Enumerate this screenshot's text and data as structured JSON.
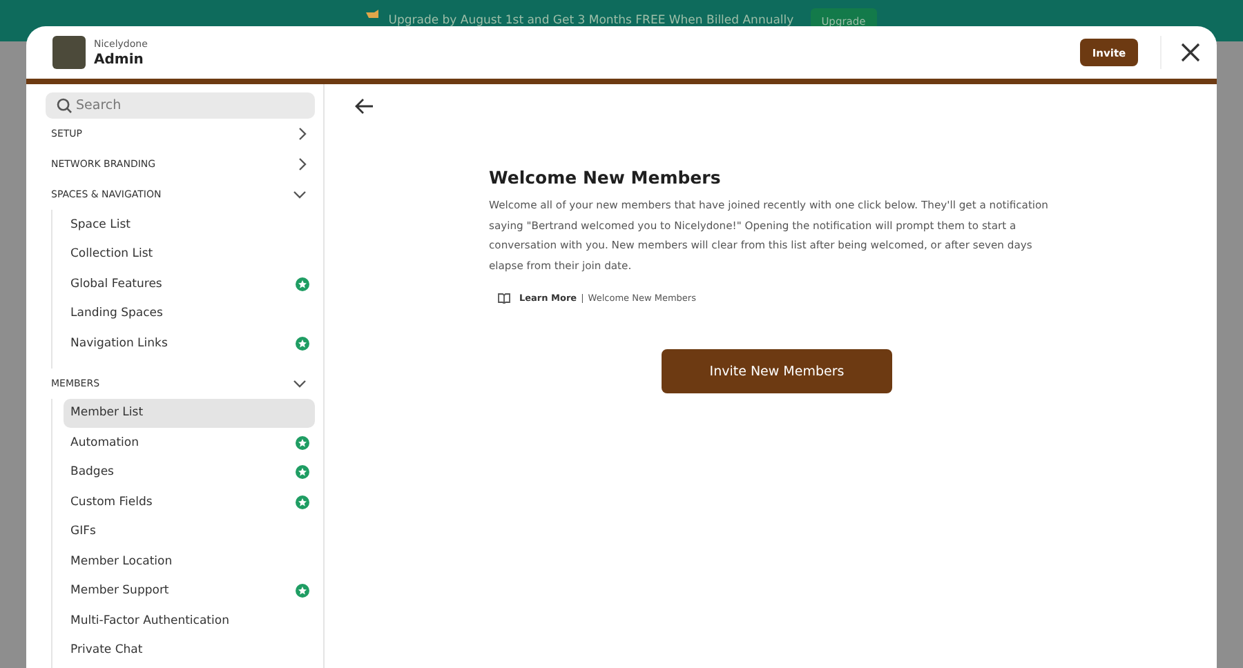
{
  "banner": {
    "text": "Upgrade by August 1st and Get 3 Months FREE When Billed Annually",
    "button": "Upgrade"
  },
  "header": {
    "network": "Nicelydone",
    "title": "Admin",
    "invite_button": "Invite"
  },
  "sidebar": {
    "search": {
      "placeholder": "Search"
    },
    "sections": [
      {
        "label": "SETUP",
        "expanded": false
      },
      {
        "label": "NETWORK BRANDING",
        "expanded": false
      },
      {
        "label": "SPACES & NAVIGATION",
        "expanded": true,
        "items": [
          {
            "label": "Space List",
            "selected": false,
            "premium": false
          },
          {
            "label": "Collection List",
            "selected": false,
            "premium": false
          },
          {
            "label": "Global Features",
            "selected": false,
            "premium": true
          },
          {
            "label": "Landing Spaces",
            "selected": false,
            "premium": false
          },
          {
            "label": "Navigation Links",
            "selected": false,
            "premium": true
          }
        ]
      },
      {
        "label": "MEMBERS",
        "expanded": true,
        "items": [
          {
            "label": "Member List",
            "selected": true,
            "premium": false
          },
          {
            "label": "Automation",
            "selected": false,
            "premium": true
          },
          {
            "label": "Badges",
            "selected": false,
            "premium": true
          },
          {
            "label": "Custom Fields",
            "selected": false,
            "premium": true
          },
          {
            "label": "GIFs",
            "selected": false,
            "premium": false
          },
          {
            "label": "Member Location",
            "selected": false,
            "premium": false
          },
          {
            "label": "Member Support",
            "selected": false,
            "premium": true
          },
          {
            "label": "Multi-Factor Authentication",
            "selected": false,
            "premium": false
          },
          {
            "label": "Private Chat",
            "selected": false,
            "premium": false
          }
        ]
      }
    ]
  },
  "main": {
    "title": "Welcome New Members",
    "description": "Welcome all of your new members that have joined recently with one click below. They'll get a notification saying \"Bertrand welcomed you to Nicelydone!\" Opening the notification will prompt them to start a conversation with you. New members will clear from this list after being welcomed, or after seven days elapse from their join date.",
    "learn_more": {
      "label": "Learn More",
      "separator": "|",
      "topic": "Welcome New Members"
    },
    "button": "Invite New Members"
  }
}
